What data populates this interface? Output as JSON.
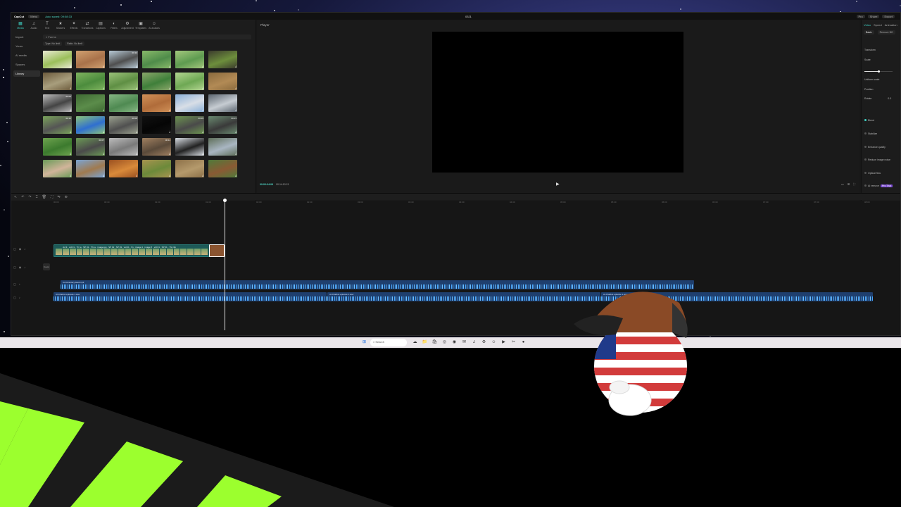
{
  "titlebar": {
    "logo": "CapCut",
    "menu": "Menu",
    "autosave": "Auto saved: 09:08:33",
    "project": "0321",
    "right": [
      "Pro",
      "Share",
      "Export"
    ]
  },
  "media": {
    "tabs": [
      {
        "label": "Media",
        "icon": "media-icon"
      },
      {
        "label": "Audio",
        "icon": "audio-icon"
      },
      {
        "label": "Text",
        "icon": "text-icon"
      },
      {
        "label": "Stickers",
        "icon": "stickers-icon"
      },
      {
        "label": "Effects",
        "icon": "effects-icon"
      },
      {
        "label": "Transitions",
        "icon": "transitions-icon"
      },
      {
        "label": "Captions",
        "icon": "captions-icon"
      },
      {
        "label": "Filters",
        "icon": "filters-icon"
      },
      {
        "label": "Adjustment",
        "icon": "adjustment-icon"
      },
      {
        "label": "Templates",
        "icon": "templates-icon"
      },
      {
        "label": "AI avatars",
        "icon": "ai-avatars-icon"
      }
    ],
    "nav": [
      "Import",
      "Yours",
      "AI media",
      "Spaces",
      "Library"
    ],
    "search": "Farms",
    "filters": [
      "Type: No limit",
      "Ratio: No limit"
    ],
    "thumbs": [
      {
        "dur": "",
        "c1": "#9bbf5a",
        "c2": "#e9e9d2"
      },
      {
        "dur": "",
        "c1": "#a9724a",
        "c2": "#d0a070"
      },
      {
        "dur": "00:10",
        "c1": "#4f4f4f",
        "c2": "#b7c9d6"
      },
      {
        "dur": "",
        "c1": "#4f8c4a",
        "c2": "#89b96a"
      },
      {
        "dur": "",
        "c1": "#5e9b50",
        "c2": "#a3c77d"
      },
      {
        "dur": "",
        "c1": "#6d8e3c",
        "c2": "#3b3b2d"
      },
      {
        "dur": "",
        "c1": "#a89e7d",
        "c2": "#6d5b3c"
      },
      {
        "dur": "",
        "c1": "#4c8c3d",
        "c2": "#7fb35f"
      },
      {
        "dur": "",
        "c1": "#5f8f44",
        "c2": "#9bc27a"
      },
      {
        "dur": "",
        "c1": "#3f7f3a",
        "c2": "#8aa66a"
      },
      {
        "dur": "",
        "c1": "#6ea854",
        "c2": "#b3d591"
      },
      {
        "dur": "",
        "c1": "#b28a55",
        "c2": "#8a6a3d"
      },
      {
        "dur": "00:06",
        "c1": "#444",
        "c2": "#bbb"
      },
      {
        "dur": "",
        "c1": "#5b8c4a",
        "c2": "#3f6a33"
      },
      {
        "dur": "",
        "c1": "#4f8a52",
        "c2": "#86b783"
      },
      {
        "dur": "",
        "c1": "#b06c3a",
        "c2": "#d09057"
      },
      {
        "dur": "",
        "c1": "#d8dee6",
        "c2": "#8ab0d8"
      },
      {
        "dur": "",
        "c1": "#c6ccd2",
        "c2": "#5c6670"
      },
      {
        "dur": "00:12",
        "c1": "#555",
        "c2": "#7aa35a"
      },
      {
        "dur": "",
        "c1": "#2f6fd0",
        "c2": "#8bc27a"
      },
      {
        "dur": "00:08",
        "c1": "#505050",
        "c2": "#9aa08e"
      },
      {
        "dur": "",
        "c1": "#050505",
        "c2": "#111"
      },
      {
        "dur": "00:09",
        "c1": "#4a4a4a",
        "c2": "#6c9450"
      },
      {
        "dur": "00:15",
        "c1": "#3a3a3a",
        "c2": "#6a8a70"
      },
      {
        "dur": "",
        "c1": "#3c7a2e",
        "c2": "#6ea34f"
      },
      {
        "dur": "00:07",
        "c1": "#4a4a4a",
        "c2": "#6b9a55"
      },
      {
        "dur": "",
        "c1": "#7a7a7a",
        "c2": "#bcbcbc"
      },
      {
        "dur": "00:11",
        "c1": "#5a4a3a",
        "c2": "#a08060"
      },
      {
        "dur": "",
        "c1": "#222",
        "c2": "#d8dde3"
      },
      {
        "dur": "",
        "c1": "#a9b6c2",
        "c2": "#5f6f5a"
      },
      {
        "dur": "",
        "c1": "#d1b49a",
        "c2": "#6a9a58"
      },
      {
        "dur": "",
        "c1": "#a07a4f",
        "c2": "#7aa4d4"
      },
      {
        "dur": "",
        "c1": "#d98a3a",
        "c2": "#9a5020"
      },
      {
        "dur": "",
        "c1": "#6c8a3a",
        "c2": "#a7934f"
      },
      {
        "dur": "",
        "c1": "#b59a6c",
        "c2": "#8c7048"
      },
      {
        "dur": "",
        "c1": "#8a5a34",
        "c2": "#4f7a3a"
      }
    ]
  },
  "player": {
    "title": "Player",
    "timecode": "00:00:04:06",
    "duration": "00:14:10:21",
    "play_icon": "▶"
  },
  "props": {
    "tabs": [
      "Video",
      "Speed",
      "Animation"
    ],
    "sub": [
      "Basic",
      "Remove BG"
    ],
    "transform": "Transform",
    "scale": "Scale",
    "scale_level": 0.5,
    "uniform": "Uniform scale",
    "position": "Position",
    "rotate": "Rotate",
    "rotate_val": "0.0",
    "blend": "Blend",
    "stabilize": "Stabilize",
    "enhance": "Enhance quality",
    "noise": "Reduce image noise",
    "flicker": "Optical flow",
    "ai_remove": "AI remove",
    "ai_tag": "Pro Trial"
  },
  "timeline": {
    "ticks": [
      "00:00",
      "00:30",
      "01:00",
      "01:30",
      "02:00",
      "02:30",
      "03:00",
      "03:30",
      "04:00",
      "04:30",
      "05:00",
      "05:30",
      "06:00",
      "06:30",
      "07:00",
      "07:30",
      "08:00",
      "08:30",
      "09:00",
      "09:30",
      "10:00",
      "10:30",
      "11:00",
      "11:30",
      "12:00"
    ],
    "cover": "Cover",
    "video_caption": "vid 3 · vid 01 · 7hr a · SP 01 · 7hr a · image.jpg · SP 02 · SP 03 · vid 21 · fin · image 4 · image 5 · vid 01 · SP 01 · 7hr clip",
    "end_clip": "outro.mp4",
    "audio1": "Commentary lead.mp3",
    "audio2a": "AI-Chatbot episode 1.wav",
    "audio2b": "AI-Chatbot episode 1.wav",
    "audio2c": "AI-Chatbot episode 1.wav"
  },
  "taskbar": {
    "search": "Search",
    "apps": [
      "start-icon",
      "search-icon",
      "widgets-icon",
      "explorer-icon",
      "store-icon",
      "edge-icon",
      "chrome-icon",
      "mail-icon",
      "spotify-icon",
      "steam-icon",
      "discord-icon",
      "terminal-icon",
      "capcut-icon",
      "obs-icon"
    ]
  },
  "colors": {
    "accent": "#3fd1c3",
    "audio": "#1f3f6e",
    "hazard": "#9cff2e"
  }
}
